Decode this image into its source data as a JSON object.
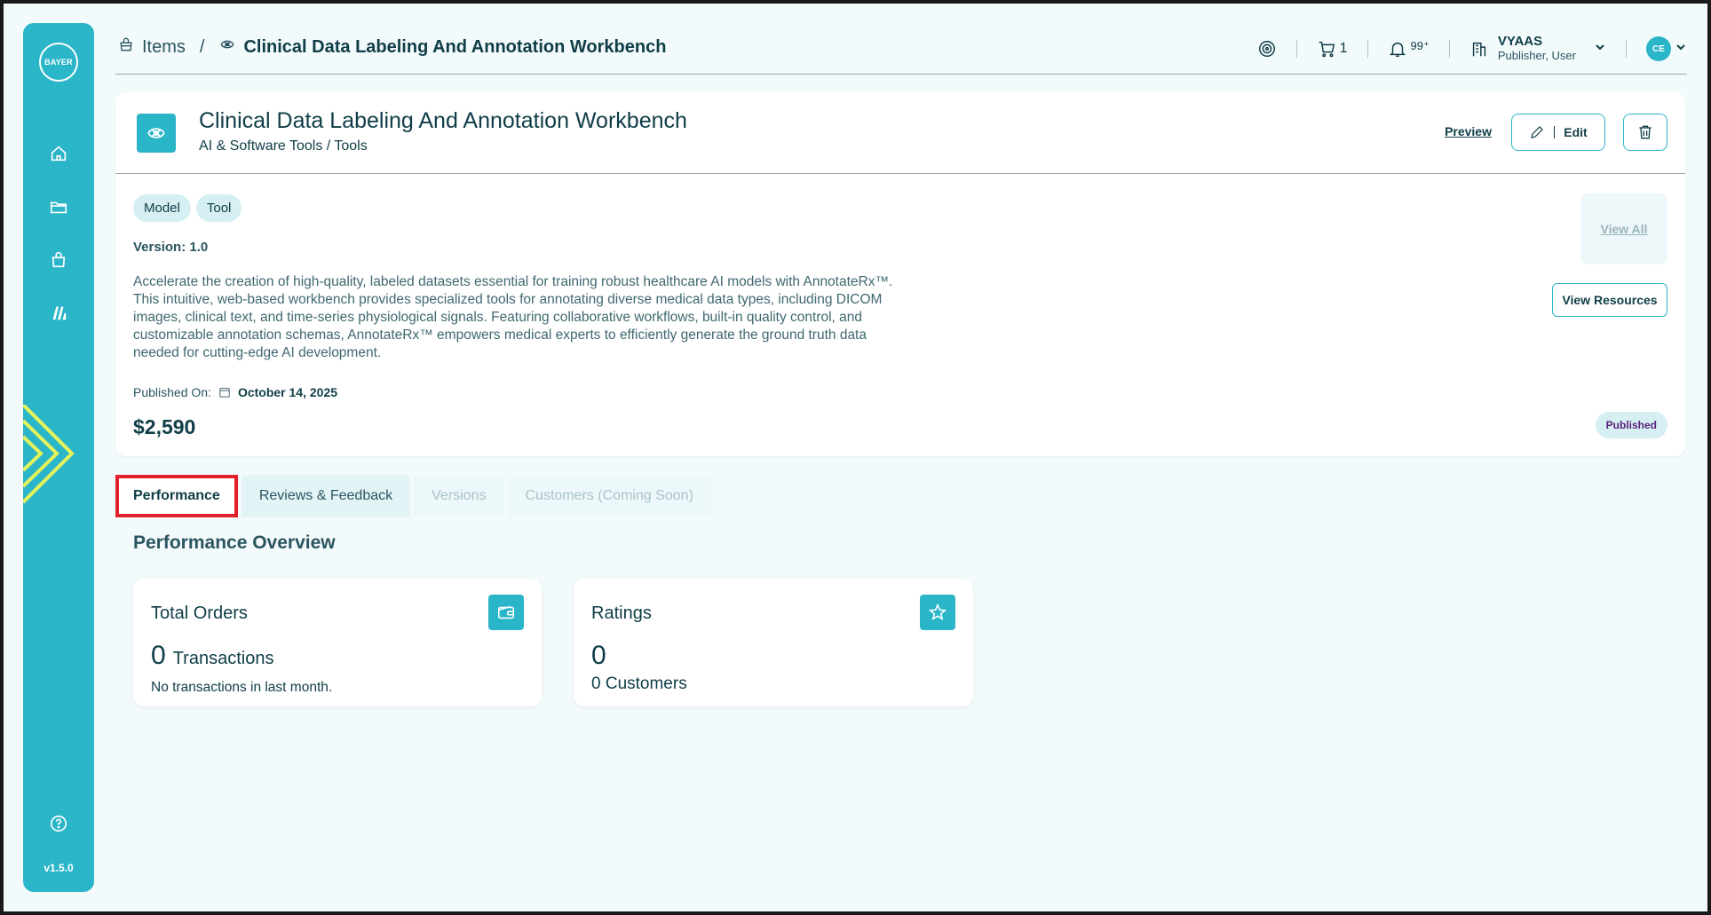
{
  "sidebar": {
    "logo_text": "BAYER",
    "version": "v1.5.0",
    "icons": [
      "home-icon",
      "folder-icon",
      "bag-icon",
      "library-icon",
      "help-icon"
    ]
  },
  "header": {
    "breadcrumb_root": "Items",
    "breadcrumb_separator": "/",
    "breadcrumb_current": "Clinical Data Labeling And Annotation Workbench",
    "cart_count": "1",
    "notification_count": "99⁺",
    "user_name": "VYAAS",
    "user_role": "Publisher, User",
    "avatar_initials": "CE"
  },
  "item": {
    "title": "Clinical Data Labeling And Annotation Workbench",
    "category": "AI & Software Tools / Tools",
    "preview_label": "Preview",
    "edit_label": "Edit",
    "tags": [
      "Model",
      "Tool"
    ],
    "version": "Version: 1.0",
    "description": "Accelerate the creation of high-quality, labeled datasets essential for training robust healthcare AI models with AnnotateRx™. This intuitive, web-based workbench provides specialized tools for annotating diverse medical data types, including DICOM images, clinical text, and time-series physiological signals. Featuring collaborative workflows, built-in quality control, and customizable annotation schemas, AnnotateRx™ empowers medical experts to efficiently generate the ground truth data needed for cutting-edge AI development.",
    "published_label": "Published On:",
    "published_date": "October 14, 2025",
    "price": "$2,590",
    "view_all_label": "View All",
    "view_resources_label": "View Resources",
    "status": "Published"
  },
  "tabs": [
    {
      "label": "Performance",
      "state": "active"
    },
    {
      "label": "Reviews & Feedback",
      "state": "normal"
    },
    {
      "label": "Versions",
      "state": "disabled"
    },
    {
      "label": "Customers (Coming Soon)",
      "state": "disabled"
    }
  ],
  "performance": {
    "title": "Performance Overview",
    "orders": {
      "title": "Total Orders",
      "value": "0",
      "unit": "Transactions",
      "note": "No transactions in last month."
    },
    "ratings": {
      "title": "Ratings",
      "value": "0",
      "customers": "0 Customers"
    }
  },
  "colors": {
    "accent": "#2bb5c8",
    "text": "#0f3d47",
    "highlight": "#e0202a",
    "status_text": "#5a1f7a"
  }
}
